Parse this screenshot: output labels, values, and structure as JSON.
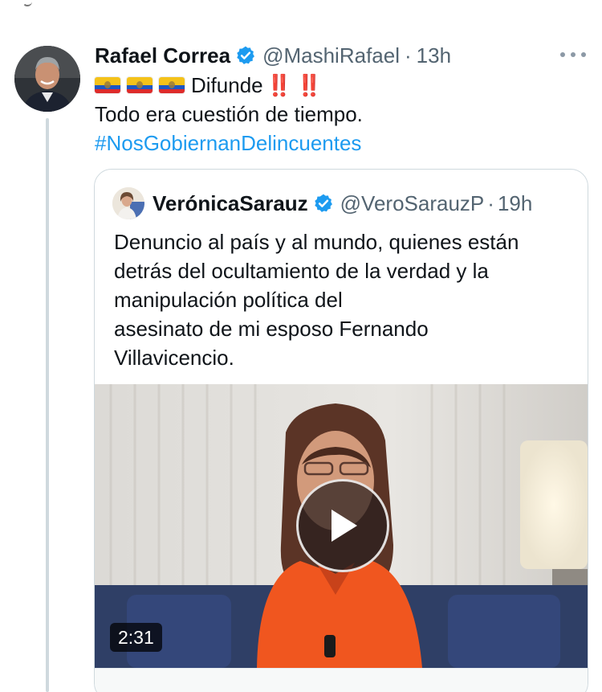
{
  "tweet": {
    "author_name": "Rafael Correa",
    "handle": "@MashiRafael",
    "separator": "·",
    "time": "13h",
    "line1_text": "Difunde",
    "line1_exclaim": "‼️ ‼️",
    "line2": "Todo era cuestión de tiempo.",
    "hashtag": "#NosGobiernanDelincuentes",
    "flags": [
      "ecuador-flag",
      "ecuador-flag",
      "ecuador-flag"
    ]
  },
  "quote": {
    "author_name": "VerónicaSarauz",
    "handle": "@VeroSarauzP",
    "separator": "·",
    "time": "19h",
    "text_lines": [
      "Denuncio al país y al mundo, quienes están",
      "detrás del ocultamiento de la verdad y la",
      "manipulación política del",
      "asesinato de mi esposo Fernando",
      "Villavicencio."
    ],
    "video": {
      "duration": "2:31",
      "play_icon": "play-icon"
    }
  },
  "colors": {
    "accent": "#1d9bf0",
    "verified": "#1d9bf0",
    "muted": "#536471",
    "border": "#cfd9de",
    "exclaim": "#e3262d"
  }
}
